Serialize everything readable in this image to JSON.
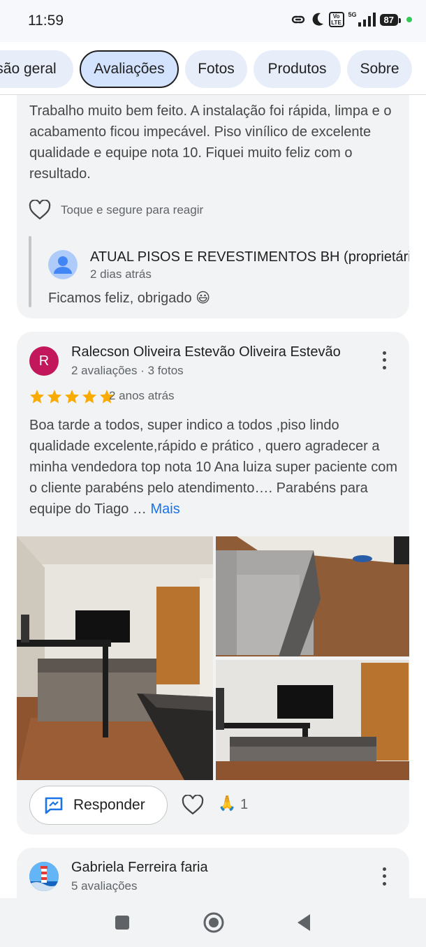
{
  "status_bar": {
    "time": "11:59",
    "volte": "Vo LTE",
    "network": "5G",
    "battery": "87"
  },
  "tabs": [
    {
      "label": "são geral"
    },
    {
      "label": "Avaliações"
    },
    {
      "label": "Fotos"
    },
    {
      "label": "Produtos"
    },
    {
      "label": "Sobre"
    }
  ],
  "review1": {
    "text": "Trabalho muito bem feito. A instalação foi rápida, limpa e o acabamento ficou impecável. Piso vinílico de excelente qualidade e equipe nota 10. Fiquei muito feliz com o resultado.",
    "react_hint": "Toque e segure para reagir",
    "owner_name": "ATUAL PISOS E REVESTIMENTOS BH (proprietário)",
    "owner_time": "2 dias atrás",
    "owner_reply": "Ficamos feliz, obrigado 😃"
  },
  "review2": {
    "avatar_letter": "R",
    "name": "Ralecson Oliveira Estevão Oliveira Estevão",
    "meta": "2 avaliações · 3 fotos",
    "rating": 5,
    "time": "2 anos atrás",
    "text": "Boa tarde a todos, super indico a todos ,piso lindo qualidade excelente,rápido e prático , quero agradecer a minha vendedora top nota 10 Ana luiza super paciente com o cliente parabéns pelo atendimento…. Parabéns para equipe do Tiago …",
    "more_link": "Mais",
    "respond_label": "Responder",
    "reaction_emoji": "🙏",
    "reaction_count": "1"
  },
  "review3": {
    "name": "Gabriela Ferreira faria",
    "meta": "5 avaliações"
  },
  "colors": {
    "accent": "#1a73e8",
    "star": "#f9ab00",
    "card_bg": "#f1f3f4",
    "chip_bg": "#e8eef9",
    "chip_active_bg": "#d3e3fd"
  }
}
